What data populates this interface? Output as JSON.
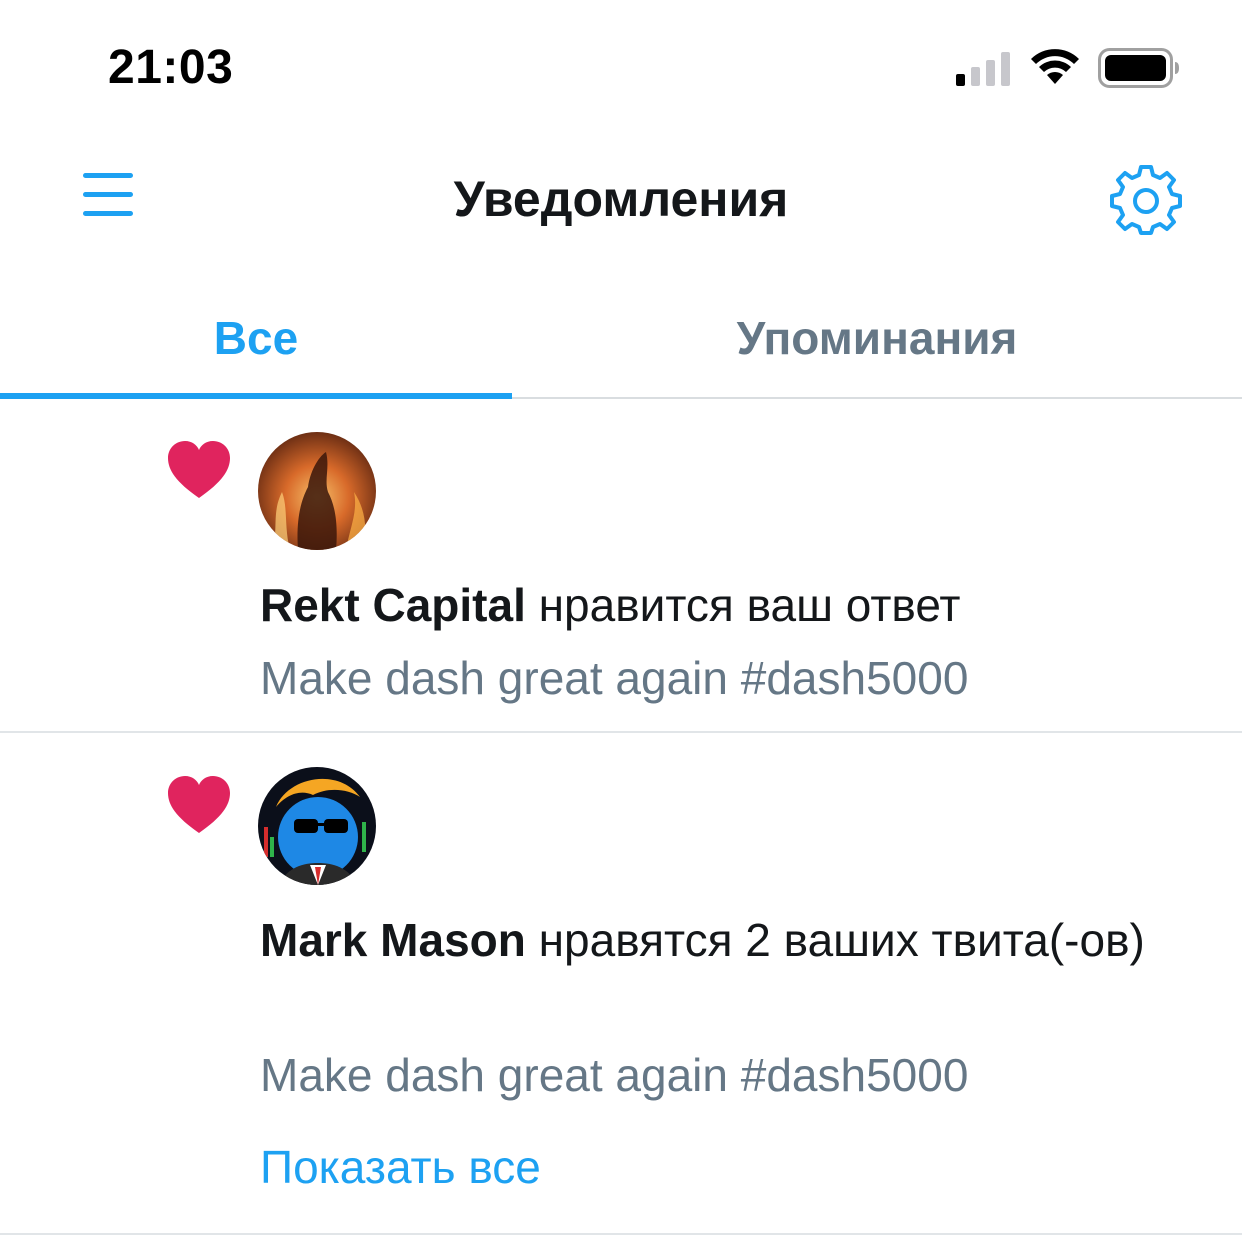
{
  "status_bar": {
    "time": "21:03",
    "signal_icon": "cellular-signal-icon",
    "wifi_icon": "wifi-icon",
    "battery_icon": "battery-icon"
  },
  "header": {
    "title": "Уведомления",
    "menu_icon": "hamburger-menu-icon",
    "settings_icon": "gear-icon"
  },
  "tabs": [
    {
      "label": "Все",
      "active": true
    },
    {
      "label": "Упоминания",
      "active": false
    }
  ],
  "notifications": [
    {
      "icon": "heart-icon",
      "user": "Rekt Capital",
      "action": "нравится ваш ответ",
      "preview": "Make dash great again #dash5000"
    },
    {
      "icon": "heart-icon",
      "user": "Mark Mason",
      "action": "нравятся 2 ваших твита(-ов)",
      "preview": "Make dash great again #dash5000",
      "show_all": "Показать все"
    }
  ],
  "colors": {
    "accent": "#1da1f2",
    "secondary_text": "#657786",
    "primary_text": "#14171a",
    "like": "#e0245e",
    "divider": "#e1e5e8"
  }
}
